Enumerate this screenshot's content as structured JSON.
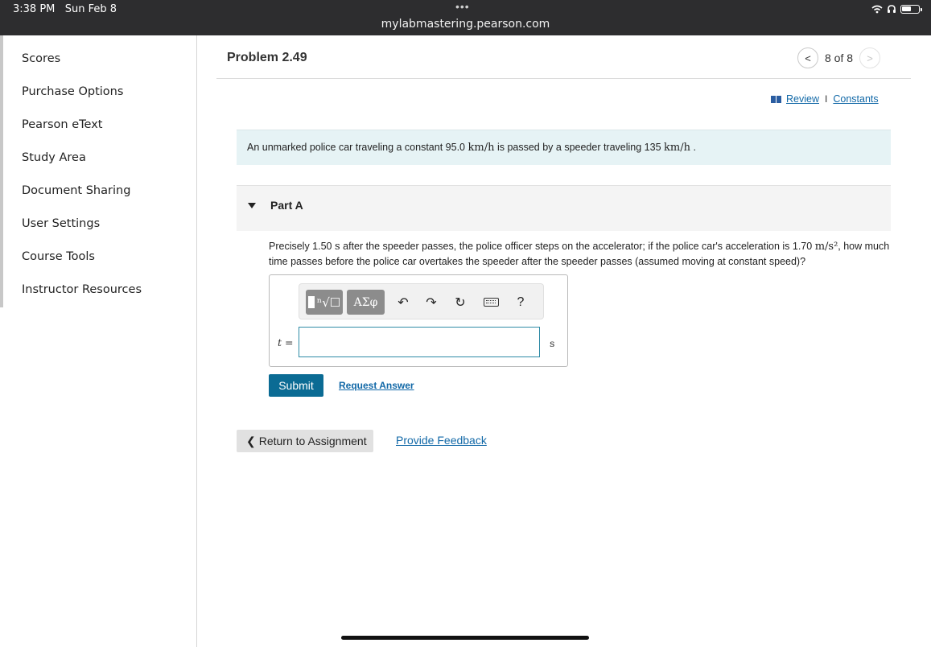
{
  "status_bar": {
    "time": "3:38 PM",
    "date": "Sun Feb 8",
    "dots": "•••",
    "url": "mylabmastering.pearson.com"
  },
  "sidebar": {
    "items": [
      {
        "label": "Scores"
      },
      {
        "label": "Purchase Options"
      },
      {
        "label": "Pearson eText"
      },
      {
        "label": "Study Area"
      },
      {
        "label": "Document Sharing"
      },
      {
        "label": "User Settings"
      },
      {
        "label": "Course Tools"
      },
      {
        "label": "Instructor Resources"
      }
    ]
  },
  "header": {
    "title": "Problem 2.49",
    "pager": "8 of 8",
    "prev_glyph": "<",
    "next_glyph": ">"
  },
  "links": {
    "review": "Review",
    "separator": "I",
    "constants": "Constants"
  },
  "problem": {
    "intro_a": "An unmarked police car traveling a constant 95.0",
    "unit_kmh": "km/h",
    "intro_b": "is passed by a speeder traveling 135",
    "intro_end": "."
  },
  "part": {
    "label": "Part A",
    "q_a": "Precisely 1.50",
    "unit_s": "s",
    "q_b": "after the speeder passes, the police officer steps on the accelerator; if the police car's acceleration is 1.70",
    "unit_ms2": "m/s²",
    "q_c": ", how much time passes before the police car overtakes the speeder after the speeder passes (assumed moving at constant speed)?"
  },
  "answer": {
    "toolbar": {
      "template_glyph": "ⁿ√☐",
      "greek": "ΑΣφ",
      "undo": "↶",
      "redo": "↷",
      "reset": "↻",
      "help": "?"
    },
    "variable": "t",
    "equals": "=",
    "value": "",
    "unit": "s"
  },
  "actions": {
    "submit": "Submit",
    "request_answer": "Request Answer",
    "return": "Return to Assignment",
    "return_glyph": "❮",
    "feedback": "Provide Feedback"
  }
}
